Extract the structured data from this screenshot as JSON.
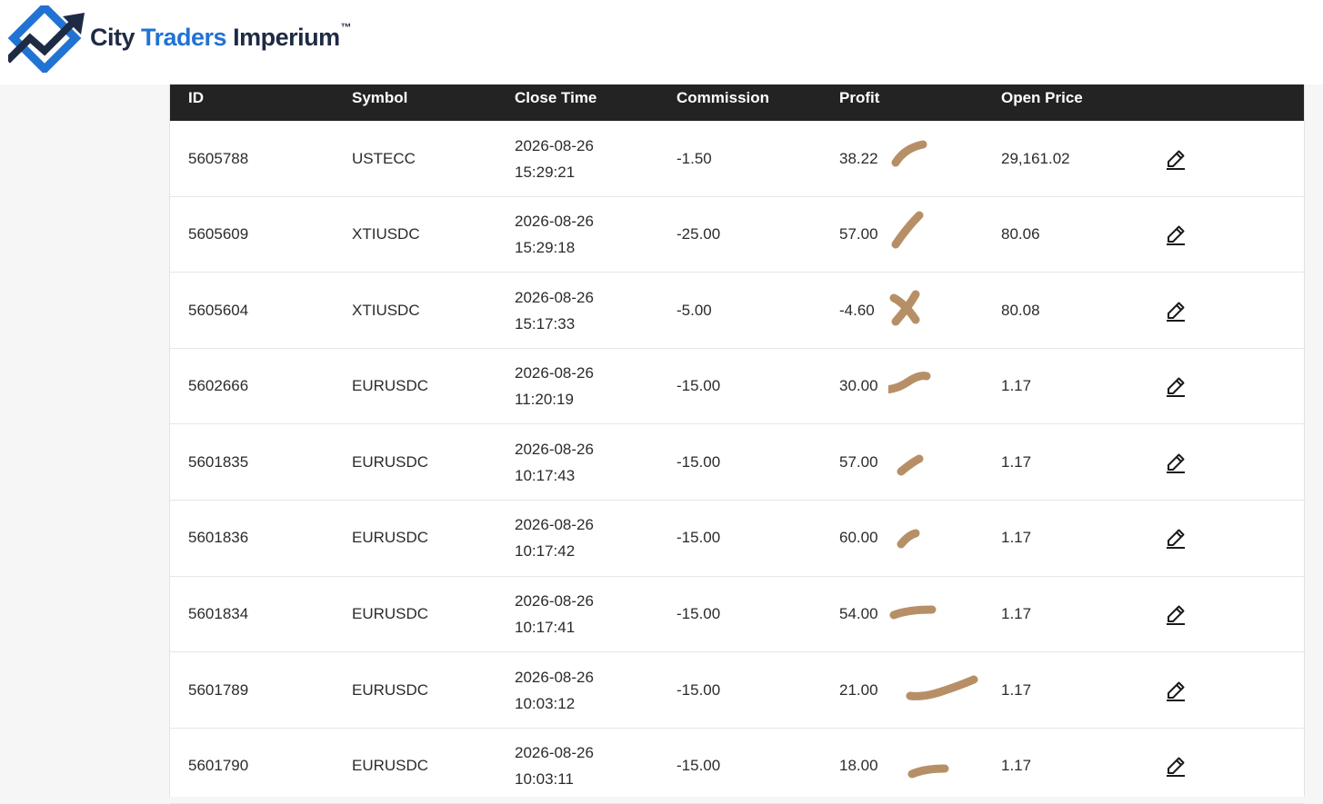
{
  "brand": {
    "word1": "City",
    "word2": "Traders",
    "word3": "Imperium",
    "trademark": "™",
    "accent_color": "#2173d3",
    "dark_color": "#1f2a44"
  },
  "table": {
    "columns": {
      "id": "ID",
      "symbol": "Symbol",
      "close_time": "Close Time",
      "commission": "Commission",
      "profit": "Profit",
      "open_price": "Open Price"
    },
    "rows": [
      {
        "id": "5605788",
        "symbol": "USTECC",
        "close_date": "2026-08-26",
        "close_clock": "15:29:21",
        "commission": "-1.50",
        "profit": "38.22",
        "open_price": "29,161.02"
      },
      {
        "id": "5605609",
        "symbol": "XTIUSDC",
        "close_date": "2026-08-26",
        "close_clock": "15:29:18",
        "commission": "-25.00",
        "profit": "57.00",
        "open_price": "80.06"
      },
      {
        "id": "5605604",
        "symbol": "XTIUSDC",
        "close_date": "2026-08-26",
        "close_clock": "15:17:33",
        "commission": "-5.00",
        "profit": "-4.60",
        "open_price": "80.08"
      },
      {
        "id": "5602666",
        "symbol": "EURUSDC",
        "close_date": "2026-08-26",
        "close_clock": "11:20:19",
        "commission": "-15.00",
        "profit": "30.00",
        "open_price": "1.17"
      },
      {
        "id": "5601835",
        "symbol": "EURUSDC",
        "close_date": "2026-08-26",
        "close_clock": "10:17:43",
        "commission": "-15.00",
        "profit": "57.00",
        "open_price": "1.17"
      },
      {
        "id": "5601836",
        "symbol": "EURUSDC",
        "close_date": "2026-08-26",
        "close_clock": "10:17:42",
        "commission": "-15.00",
        "profit": "60.00",
        "open_price": "1.17"
      },
      {
        "id": "5601834",
        "symbol": "EURUSDC",
        "close_date": "2026-08-26",
        "close_clock": "10:17:41",
        "commission": "-15.00",
        "profit": "54.00",
        "open_price": "1.17"
      },
      {
        "id": "5601789",
        "symbol": "EURUSDC",
        "close_date": "2026-08-26",
        "close_clock": "10:03:12",
        "commission": "-15.00",
        "profit": "21.00",
        "open_price": "1.17"
      },
      {
        "id": "5601790",
        "symbol": "EURUSDC",
        "close_date": "2026-08-26",
        "close_clock": "10:03:11",
        "commission": "-15.00",
        "profit": "18.00",
        "open_price": "1.17"
      }
    ]
  },
  "icons": {
    "edit": "pencil-edit-icon",
    "logo": "chart-arrow-logo-icon"
  },
  "colors": {
    "header_bg": "#232323",
    "brush_mark": "#b78f67"
  }
}
